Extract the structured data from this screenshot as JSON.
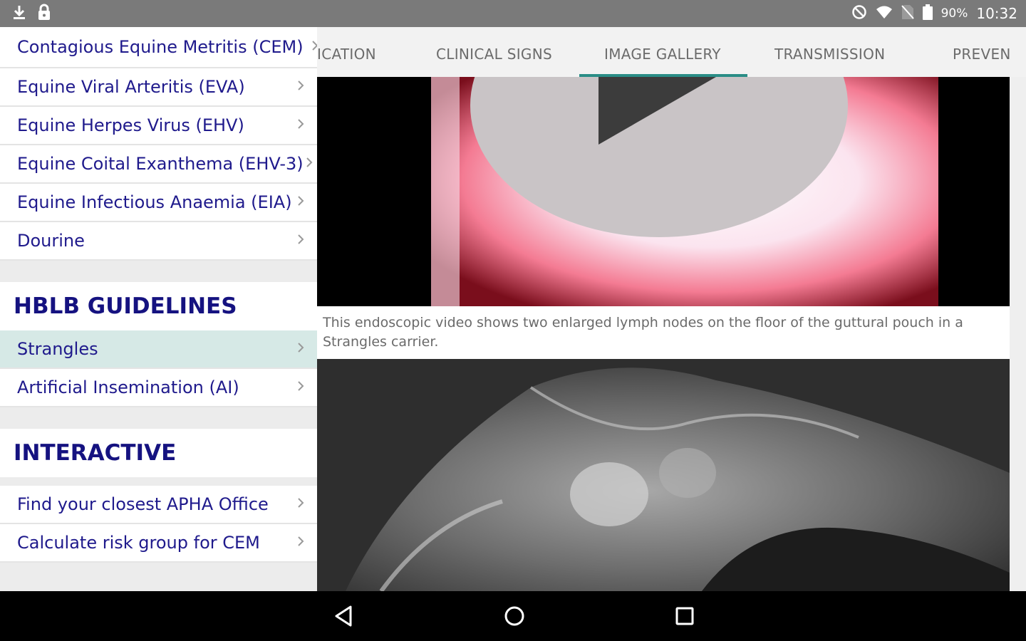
{
  "status_bar": {
    "battery_percent": "90%",
    "time": "10:32",
    "icons": [
      "download-icon",
      "lock-icon",
      "do-not-disturb-icon",
      "wifi-icon",
      "no-sim-icon",
      "battery-icon"
    ]
  },
  "sidebar": {
    "disease_items": [
      {
        "label": "Contagious Equine Metritis (CEM)"
      },
      {
        "label": "Equine Viral Arteritis (EVA)"
      },
      {
        "label": "Equine Herpes Virus (EHV)"
      },
      {
        "label": "Equine Coital Exanthema (EHV-3)"
      },
      {
        "label": "Equine Infectious Anaemia (EIA)"
      },
      {
        "label": "Dourine"
      }
    ],
    "hblb_heading": "HBLB GUIDELINES",
    "hblb_items": [
      {
        "label": "Strangles",
        "selected": true
      },
      {
        "label": "Artificial Insemination (AI)"
      }
    ],
    "interactive_heading": "INTERACTIVE",
    "interactive_items": [
      {
        "label": "Find your closest APHA Office"
      },
      {
        "label": "Calculate risk group for CEM"
      }
    ]
  },
  "tabs": {
    "items": [
      "ICATION",
      "CLINICAL SIGNS",
      "IMAGE GALLERY",
      "TRANSMISSION",
      "PREVEN"
    ],
    "active": "IMAGE GALLERY"
  },
  "gallery": {
    "caption": "This endoscopic video shows two enlarged lymph nodes on the floor of the guttural pouch in a Strangles carrier."
  },
  "colors": {
    "link_text": "#1f1a8c",
    "heading_text": "#151280",
    "selected_row": "#d6e9e6",
    "tab_indicator": "#2a8d86",
    "status_bar": "#7a7a7a"
  },
  "nav_bar": {
    "icons": [
      "back-icon",
      "home-icon",
      "recents-icon"
    ]
  }
}
